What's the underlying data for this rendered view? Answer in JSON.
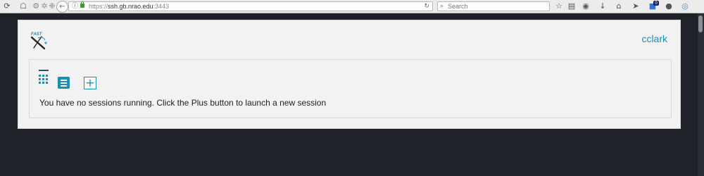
{
  "browser": {
    "url_scheme": "https://",
    "url_host": "ssh.gb.nrao.edu",
    "url_port": ":3443",
    "search_placeholder": "Search",
    "notification_count": "0"
  },
  "app": {
    "logo_text": "FAST",
    "username": "cclark",
    "empty_message": "You have no sessions running. Click the Plus button to launch a new session",
    "add_symbol": "+"
  },
  "colors": {
    "accent": "#1a8fb4",
    "page_background": "#1f2329",
    "panel_background": "#f2f2f2"
  },
  "icons": {
    "toolbar": [
      "firefox-icon",
      "library-icon",
      "settings-icon",
      "sync-icon",
      "tab-icon",
      "back-icon",
      "bookmark-star-icon",
      "reader-icon",
      "pocket-icon",
      "download-icon",
      "home-icon",
      "send-icon",
      "notification-icon",
      "chat-icon",
      "globe-icon"
    ],
    "app": [
      "fastx-logo-icon",
      "grid-view-icon",
      "list-view-icon",
      "plus-icon"
    ]
  }
}
